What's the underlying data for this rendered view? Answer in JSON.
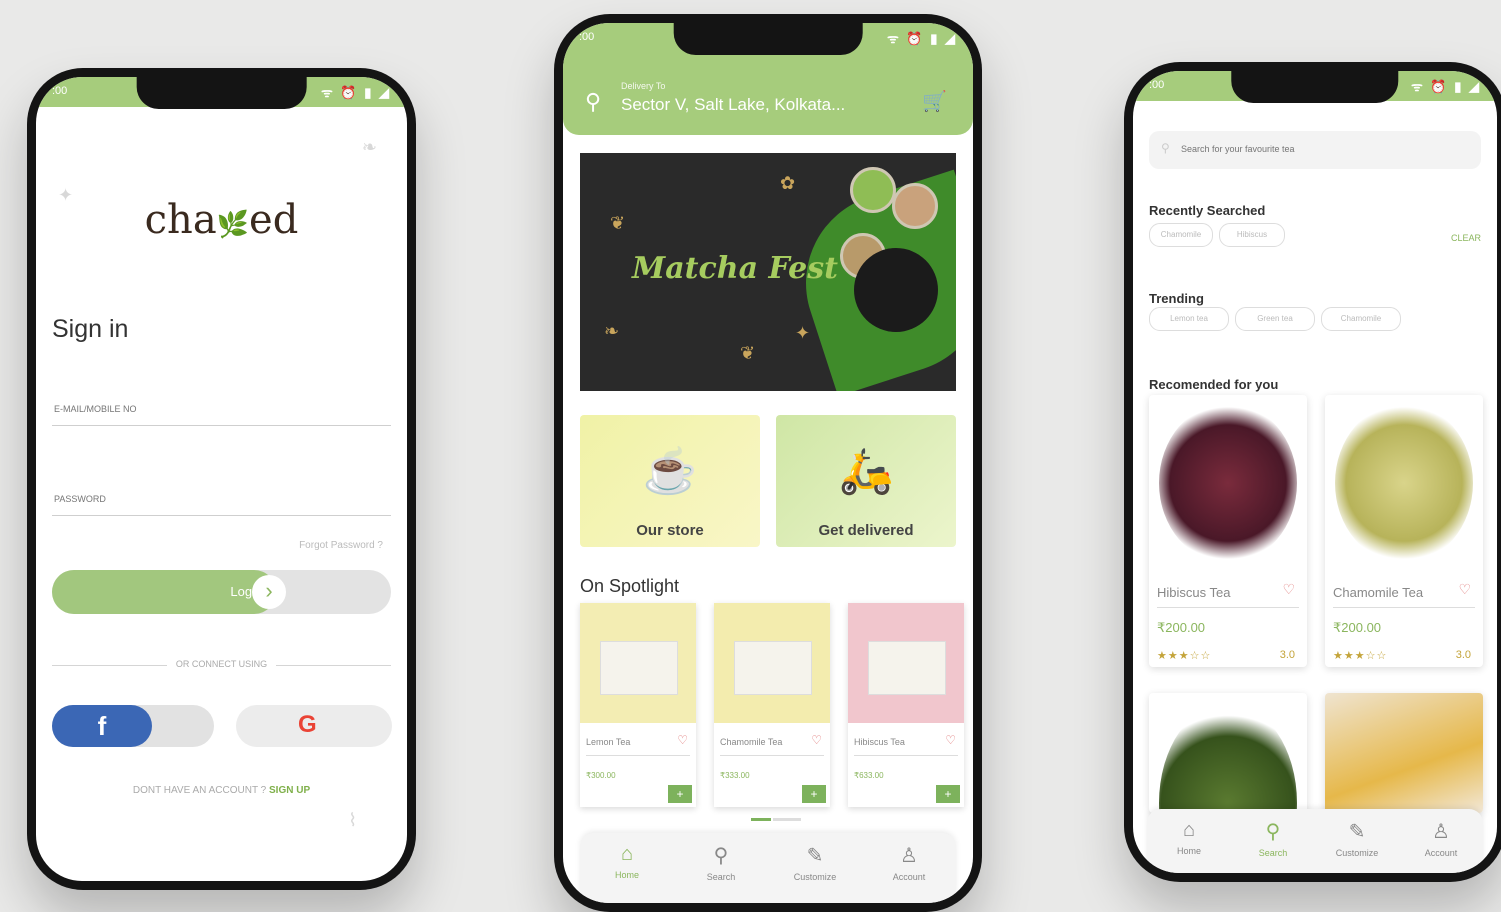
{
  "status_time": ":00",
  "status_icons": "ᯤ ⏰ ▮ ◢",
  "login_screen": {
    "logo_left": "cha",
    "logo_right": "ed",
    "title": "Sign in",
    "email_placeholder": "E-MAIL/MOBILE NO",
    "password_placeholder": "PASSWORD",
    "forgot": "Forgot Password ?",
    "login_label": "Login",
    "or_connect": "OR CONNECT USING",
    "facebook": "f",
    "google": "G",
    "signup_prompt": "DONT HAVE AN ACCOUNT ?",
    "signup_link": "SIGN UP"
  },
  "home_screen": {
    "delivery_to": "Delivery To",
    "address": "Sector V, Salt Lake, Kolkata...",
    "banner_title": "Matcha Fest",
    "tiles": [
      {
        "label": "Our store"
      },
      {
        "label": "Get delivered"
      }
    ],
    "spotlight_title": "On Spotlight",
    "spotlight": [
      {
        "name": "Lemon Tea",
        "price": "₹300.00",
        "color": "#f3edb3"
      },
      {
        "name": "Chamomile Tea",
        "price": "₹333.00",
        "color": "#f3ecae"
      },
      {
        "name": "Hibiscus Tea",
        "price": "₹633.00",
        "color": "#f1c6cd"
      }
    ],
    "nav": [
      {
        "label": "Home",
        "icon": "home-icon"
      },
      {
        "label": "Search",
        "icon": "search-icon"
      },
      {
        "label": "Customize",
        "icon": "pencil-icon"
      },
      {
        "label": "Account",
        "icon": "user-icon"
      }
    ]
  },
  "search_screen": {
    "search_placeholder": "Search for your favourite tea",
    "recently_searched": "Recently Searched",
    "clear": "CLEAR",
    "recent_chips": [
      "Chamomile",
      "Hibiscus"
    ],
    "trending": "Trending",
    "trending_chips": [
      "Lemon tea",
      "Green tea",
      "Chamomile"
    ],
    "recommended": "Recomended for you",
    "products": [
      {
        "name": "Hibiscus Tea",
        "price": "₹200.00",
        "stars": "★★★☆☆",
        "rating": "3.0"
      },
      {
        "name": "Chamomile Tea",
        "price": "₹200.00",
        "stars": "★★★☆☆",
        "rating": "3.0"
      }
    ],
    "nav": [
      {
        "label": "Home",
        "icon": "home-icon"
      },
      {
        "label": "Search",
        "icon": "search-icon"
      },
      {
        "label": "Customize",
        "icon": "pencil-icon"
      },
      {
        "label": "Account",
        "icon": "user-icon"
      }
    ]
  },
  "colors": {
    "brand_green": "#a6cc7c",
    "accent_green": "#7db25c",
    "heart": "#e07a7a"
  }
}
